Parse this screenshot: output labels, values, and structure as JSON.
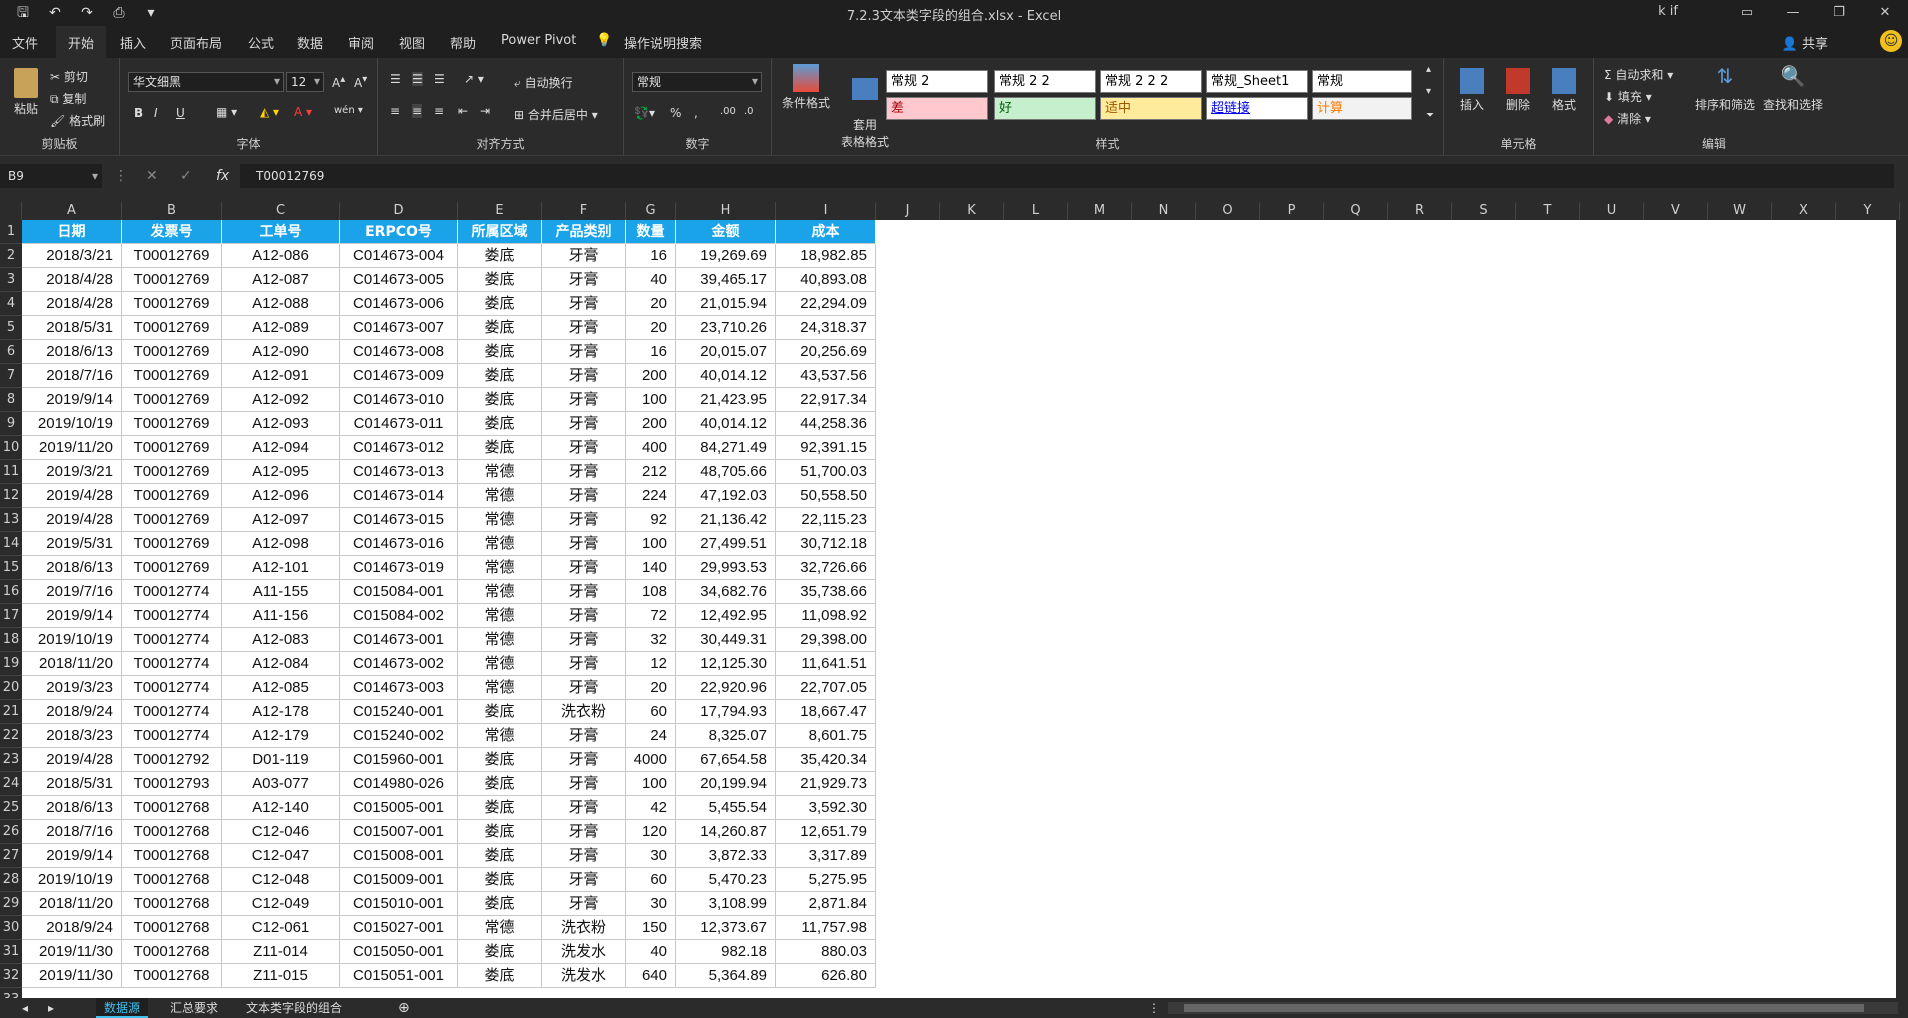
{
  "titlebar": {
    "document_title": "7.2.3文本类字段的组合.xlsx  -  Excel",
    "user": "k if",
    "qat_icons": [
      "save-icon",
      "undo-icon",
      "redo-icon",
      "print-preview-icon",
      "customize-icon"
    ]
  },
  "menu": {
    "tabs": [
      "文件",
      "开始",
      "插入",
      "页面布局",
      "公式",
      "数据",
      "审阅",
      "视图",
      "帮助",
      "Power Pivot"
    ],
    "active_tab": "开始",
    "tell_me": "操作说明搜索",
    "share": "共享"
  },
  "ribbon": {
    "clipboard": {
      "paste": "粘贴",
      "cut": "剪切",
      "copy": "复制",
      "format_painter": "格式刷",
      "label": "剪贴板"
    },
    "font": {
      "name": "华文细黑",
      "size": "12",
      "bold": "B",
      "italic": "I",
      "underline": "U",
      "label": "字体"
    },
    "alignment": {
      "wrap": "自动换行",
      "merge": "合并后居中",
      "label": "对齐方式"
    },
    "number": {
      "format": "常规",
      "label": "数字"
    },
    "styles": {
      "conditional": "条件格式",
      "table": "套用\n表格格式",
      "cells": [
        {
          "text": "常规 2",
          "bg": "#ffffff",
          "fg": "#000000"
        },
        {
          "text": "常规 2 2",
          "bg": "#ffffff",
          "fg": "#000000"
        },
        {
          "text": "常规 2 2 2",
          "bg": "#ffffff",
          "fg": "#000000"
        },
        {
          "text": "常规_Sheet1",
          "bg": "#ffffff",
          "fg": "#000000"
        },
        {
          "text": "常规",
          "bg": "#ffffff",
          "fg": "#000000"
        },
        {
          "text": "差",
          "bg": "#ffc7ce",
          "fg": "#9c0006"
        },
        {
          "text": "好",
          "bg": "#c6efce",
          "fg": "#006100"
        },
        {
          "text": "适中",
          "bg": "#ffeb9c",
          "fg": "#9c5700"
        },
        {
          "text": "超链接",
          "bg": "#ffffff",
          "fg": "#0000ee"
        },
        {
          "text": "计算",
          "bg": "#f2f2f2",
          "fg": "#fa7d00"
        }
      ],
      "label": "样式"
    },
    "cells": {
      "insert": "插入",
      "delete": "删除",
      "format": "格式",
      "label": "单元格"
    },
    "editing": {
      "autosum": "自动求和",
      "fill": "填充",
      "clear": "清除",
      "sort": "排序和筛选",
      "find": "查找和选择",
      "label": "编辑"
    }
  },
  "formula_bar": {
    "name_box": "B9",
    "formula": "T00012769"
  },
  "columns": [
    "A",
    "B",
    "C",
    "D",
    "E",
    "F",
    "G",
    "H",
    "I",
    "J",
    "K",
    "L",
    "M",
    "N",
    "O",
    "P",
    "Q",
    "R",
    "S",
    "T",
    "U",
    "V",
    "W",
    "X",
    "Y"
  ],
  "table": {
    "headers": [
      "日期",
      "发票号",
      "工单号",
      "ERPCO号",
      "所属区域",
      "产品类别",
      "数量",
      "金额",
      "成本"
    ],
    "rows": [
      [
        "2018/3/21",
        "T00012769",
        "A12-086",
        "C014673-004",
        "娄底",
        "牙膏",
        "16",
        "19,269.69",
        "18,982.85"
      ],
      [
        "2018/4/28",
        "T00012769",
        "A12-087",
        "C014673-005",
        "娄底",
        "牙膏",
        "40",
        "39,465.17",
        "40,893.08"
      ],
      [
        "2018/4/28",
        "T00012769",
        "A12-088",
        "C014673-006",
        "娄底",
        "牙膏",
        "20",
        "21,015.94",
        "22,294.09"
      ],
      [
        "2018/5/31",
        "T00012769",
        "A12-089",
        "C014673-007",
        "娄底",
        "牙膏",
        "20",
        "23,710.26",
        "24,318.37"
      ],
      [
        "2018/6/13",
        "T00012769",
        "A12-090",
        "C014673-008",
        "娄底",
        "牙膏",
        "16",
        "20,015.07",
        "20,256.69"
      ],
      [
        "2018/7/16",
        "T00012769",
        "A12-091",
        "C014673-009",
        "娄底",
        "牙膏",
        "200",
        "40,014.12",
        "43,537.56"
      ],
      [
        "2019/9/14",
        "T00012769",
        "A12-092",
        "C014673-010",
        "娄底",
        "牙膏",
        "100",
        "21,423.95",
        "22,917.34"
      ],
      [
        "2019/10/19",
        "T00012769",
        "A12-093",
        "C014673-011",
        "娄底",
        "牙膏",
        "200",
        "40,014.12",
        "44,258.36"
      ],
      [
        "2019/11/20",
        "T00012769",
        "A12-094",
        "C014673-012",
        "娄底",
        "牙膏",
        "400",
        "84,271.49",
        "92,391.15"
      ],
      [
        "2019/3/21",
        "T00012769",
        "A12-095",
        "C014673-013",
        "常德",
        "牙膏",
        "212",
        "48,705.66",
        "51,700.03"
      ],
      [
        "2019/4/28",
        "T00012769",
        "A12-096",
        "C014673-014",
        "常德",
        "牙膏",
        "224",
        "47,192.03",
        "50,558.50"
      ],
      [
        "2019/4/28",
        "T00012769",
        "A12-097",
        "C014673-015",
        "常德",
        "牙膏",
        "92",
        "21,136.42",
        "22,115.23"
      ],
      [
        "2019/5/31",
        "T00012769",
        "A12-098",
        "C014673-016",
        "常德",
        "牙膏",
        "100",
        "27,499.51",
        "30,712.18"
      ],
      [
        "2018/6/13",
        "T00012769",
        "A12-101",
        "C014673-019",
        "常德",
        "牙膏",
        "140",
        "29,993.53",
        "32,726.66"
      ],
      [
        "2019/7/16",
        "T00012774",
        "A11-155",
        "C015084-001",
        "常德",
        "牙膏",
        "108",
        "34,682.76",
        "35,738.66"
      ],
      [
        "2019/9/14",
        "T00012774",
        "A11-156",
        "C015084-002",
        "常德",
        "牙膏",
        "72",
        "12,492.95",
        "11,098.92"
      ],
      [
        "2019/10/19",
        "T00012774",
        "A12-083",
        "C014673-001",
        "常德",
        "牙膏",
        "32",
        "30,449.31",
        "29,398.00"
      ],
      [
        "2018/11/20",
        "T00012774",
        "A12-084",
        "C014673-002",
        "常德",
        "牙膏",
        "12",
        "12,125.30",
        "11,641.51"
      ],
      [
        "2019/3/23",
        "T00012774",
        "A12-085",
        "C014673-003",
        "常德",
        "牙膏",
        "20",
        "22,920.96",
        "22,707.05"
      ],
      [
        "2018/9/24",
        "T00012774",
        "A12-178",
        "C015240-001",
        "娄底",
        "洗衣粉",
        "60",
        "17,794.93",
        "18,667.47"
      ],
      [
        "2018/3/23",
        "T00012774",
        "A12-179",
        "C015240-002",
        "常德",
        "牙膏",
        "24",
        "8,325.07",
        "8,601.75"
      ],
      [
        "2019/4/28",
        "T00012792",
        "D01-119",
        "C015960-001",
        "娄底",
        "牙膏",
        "4000",
        "67,654.58",
        "35,420.34"
      ],
      [
        "2018/5/31",
        "T00012793",
        "A03-077",
        "C014980-026",
        "娄底",
        "牙膏",
        "100",
        "20,199.94",
        "21,929.73"
      ],
      [
        "2018/6/13",
        "T00012768",
        "A12-140",
        "C015005-001",
        "娄底",
        "牙膏",
        "42",
        "5,455.54",
        "3,592.30"
      ],
      [
        "2018/7/16",
        "T00012768",
        "C12-046",
        "C015007-001",
        "娄底",
        "牙膏",
        "120",
        "14,260.87",
        "12,651.79"
      ],
      [
        "2019/9/14",
        "T00012768",
        "C12-047",
        "C015008-001",
        "娄底",
        "牙膏",
        "30",
        "3,872.33",
        "3,317.89"
      ],
      [
        "2019/10/19",
        "T00012768",
        "C12-048",
        "C015009-001",
        "娄底",
        "牙膏",
        "60",
        "5,470.23",
        "5,275.95"
      ],
      [
        "2018/11/20",
        "T00012768",
        "C12-049",
        "C015010-001",
        "娄底",
        "牙膏",
        "30",
        "3,108.99",
        "2,871.84"
      ],
      [
        "2018/9/24",
        "T00012768",
        "C12-061",
        "C015027-001",
        "常德",
        "洗衣粉",
        "150",
        "12,373.67",
        "11,757.98"
      ],
      [
        "2019/11/30",
        "T00012768",
        "Z11-014",
        "C015050-001",
        "娄底",
        "洗发水",
        "40",
        "982.18",
        "880.03"
      ],
      [
        "2019/11/30",
        "T00012768",
        "Z11-015",
        "C015051-001",
        "娄底",
        "洗发水",
        "640",
        "5,364.89",
        "626.80"
      ]
    ]
  },
  "sheets": [
    "数据源",
    "汇总要求",
    "文本类字段的组合"
  ],
  "active_sheet": "数据源"
}
